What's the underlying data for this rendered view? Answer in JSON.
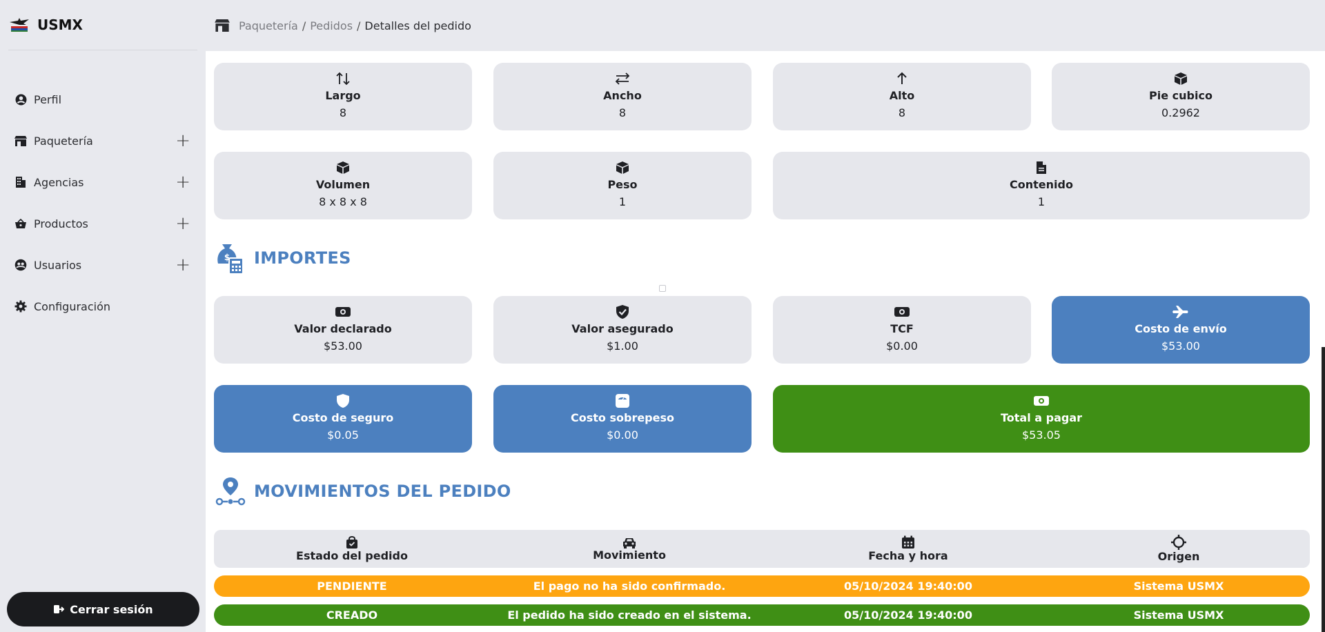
{
  "brand": {
    "name": "USMX"
  },
  "sidebar": {
    "items": [
      {
        "label": "Perfil",
        "icon": "user-circle-icon",
        "expandable": false
      },
      {
        "label": "Paquetería",
        "icon": "store-icon",
        "expandable": true
      },
      {
        "label": "Agencias",
        "icon": "building-icon",
        "expandable": true
      },
      {
        "label": "Productos",
        "icon": "basket-icon",
        "expandable": true
      },
      {
        "label": "Usuarios",
        "icon": "users-icon",
        "expandable": true
      },
      {
        "label": "Configuración",
        "icon": "gear-icon",
        "expandable": false
      }
    ],
    "logout_label": "Cerrar sesión"
  },
  "breadcrumb": {
    "part1": "Paquetería",
    "part2": "Pedidos",
    "current": "Detalles del pedido",
    "separator": "/"
  },
  "dimensions": {
    "largo": {
      "label": "Largo",
      "value": "8"
    },
    "ancho": {
      "label": "Ancho",
      "value": "8"
    },
    "alto": {
      "label": "Alto",
      "value": "8"
    },
    "pie_cubico": {
      "label": "Pie cubico",
      "value": "0.2962"
    },
    "volumen": {
      "label": "Volumen",
      "value": "8 x 8 x 8"
    },
    "peso": {
      "label": "Peso",
      "value": "1"
    },
    "contenido": {
      "label": "Contenido",
      "value": "1"
    }
  },
  "importes": {
    "title": "IMPORTES",
    "valor_declarado": {
      "label": "Valor declarado",
      "value": "$53.00"
    },
    "valor_asegurado": {
      "label": "Valor asegurado",
      "value": "$1.00"
    },
    "tcf": {
      "label": "TCF",
      "value": "$0.00"
    },
    "costo_envio": {
      "label": "Costo de envío",
      "value": "$53.00"
    },
    "costo_seguro": {
      "label": "Costo de seguro",
      "value": "$0.05"
    },
    "costo_sobrepeso": {
      "label": "Costo sobrepeso",
      "value": "$0.00"
    },
    "total": {
      "label": "Total a pagar",
      "value": "$53.05"
    }
  },
  "movimientos": {
    "title": "MOVIMIENTOS DEL PEDIDO",
    "headers": {
      "estado": "Estado del pedido",
      "movimiento": "Movimiento",
      "fecha": "Fecha y hora",
      "origen": "Origen"
    },
    "rows": [
      {
        "estado": "PENDIENTE",
        "movimiento": "El pago no ha sido confirmado.",
        "fecha": "05/10/2024 19:40:00",
        "origen": "Sistema USMX",
        "color": "#fea510"
      },
      {
        "estado": "CREADO",
        "movimiento": "El pedido ha sido creado en el sistema.",
        "fecha": "05/10/2024 19:40:00",
        "origen": "Sistema USMX",
        "color": "#3f8f15"
      }
    ]
  },
  "colors": {
    "accent": "#4c80bf",
    "success": "#3f8f15",
    "warning": "#fea510",
    "sidebar_bg": "#e8e9ee",
    "card_bg": "#e6e7ec"
  }
}
